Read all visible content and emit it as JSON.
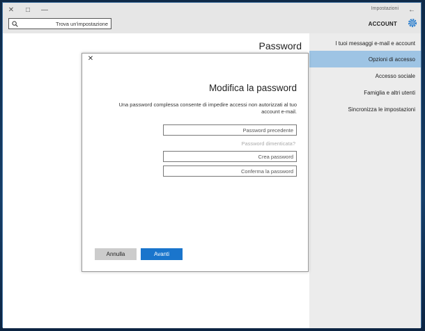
{
  "window": {
    "title": "Impostazioni",
    "min_glyph": "—",
    "max_glyph": "□",
    "close_glyph": "✕",
    "back_glyph": "←"
  },
  "header": {
    "section_title": "ACCOUNT",
    "search_placeholder": "Trova un'impostazione"
  },
  "main": {
    "page_heading": "Password"
  },
  "sidebar": {
    "items": [
      {
        "label": "I tuoi messaggi e-mail e account",
        "active": false
      },
      {
        "label": "Opzioni di accesso",
        "active": true
      },
      {
        "label": "Accesso sociale",
        "active": false
      },
      {
        "label": "Famiglia e altri utenti",
        "active": false
      },
      {
        "label": "Sincronizza le impostazioni",
        "active": false
      }
    ]
  },
  "dialog": {
    "close_glyph": "✕",
    "title": "Modifica la password",
    "description": "Una password complessa consente di impedire accessi non autorizzati al tuo account e-mail.",
    "fields": {
      "current_placeholder": "Password precedente",
      "forgot_hint": "Password dimenticata?",
      "new_placeholder": "Crea password",
      "confirm_placeholder": "Conferma la password"
    },
    "buttons": {
      "cancel": "Annulla",
      "next": "Avanti"
    }
  },
  "colors": {
    "accent": "#1a75cc",
    "sidebar_active": "#9ec4e4",
    "chrome": "#e6e6e6"
  }
}
